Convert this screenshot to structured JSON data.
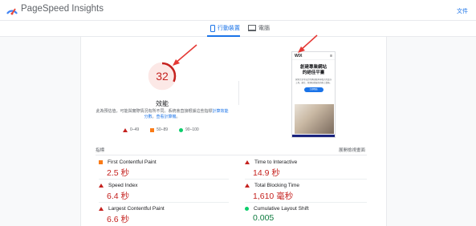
{
  "header": {
    "brand": "PageSpeed Insights",
    "docs_link": "文件"
  },
  "tabs": [
    {
      "label": "行動裝置",
      "active": true
    },
    {
      "label": "電腦",
      "active": false
    }
  ],
  "score": {
    "value": "32",
    "fraction": 0.32,
    "label": "效能",
    "note_text": "此為預估值，可能與實際情況有所不同。系統會直接根據這些指標",
    "note_link1": "計算效能分數",
    "note_text2": "。",
    "note_link2": "查看計算機",
    "note_text3": "。"
  },
  "legend": [
    {
      "label": "0–49",
      "shape": "triangle",
      "color": "#c5221f"
    },
    {
      "label": "50–89",
      "shape": "square",
      "color": "#fa7b17"
    },
    {
      "label": "90–100",
      "shape": "circle",
      "color": "#0cce6b"
    }
  ],
  "preview": {
    "logo": "WIX",
    "title_line1": "創建專業網站",
    "title_line2": "的絕佳平臺",
    "subtitle": "探索完全可自訂的網站範本與強大的設計工具，建立、管理和發展您的線上業務。",
    "button": "立即開始"
  },
  "metrics_header": {
    "left": "指標",
    "right": "展開檢視畫面"
  },
  "metrics": [
    {
      "name": "First Contentful Paint",
      "value": "2.5 秒",
      "status": "average"
    },
    {
      "name": "Time to Interactive",
      "value": "14.9 秒",
      "status": "fail"
    },
    {
      "name": "Speed Index",
      "value": "6.4 秒",
      "status": "fail"
    },
    {
      "name": "Total Blocking Time",
      "value": "1,610 毫秒",
      "status": "fail"
    },
    {
      "name": "Largest Contentful Paint",
      "value": "6.6 秒",
      "status": "fail"
    },
    {
      "name": "Cumulative Layout Shift",
      "value": "0.005",
      "status": "pass"
    }
  ],
  "colors": {
    "fail": "#c5221f",
    "average": "#fa7b17",
    "pass": "#0cce6b",
    "accent": "#1a73e8",
    "annotation": "#e53935"
  }
}
